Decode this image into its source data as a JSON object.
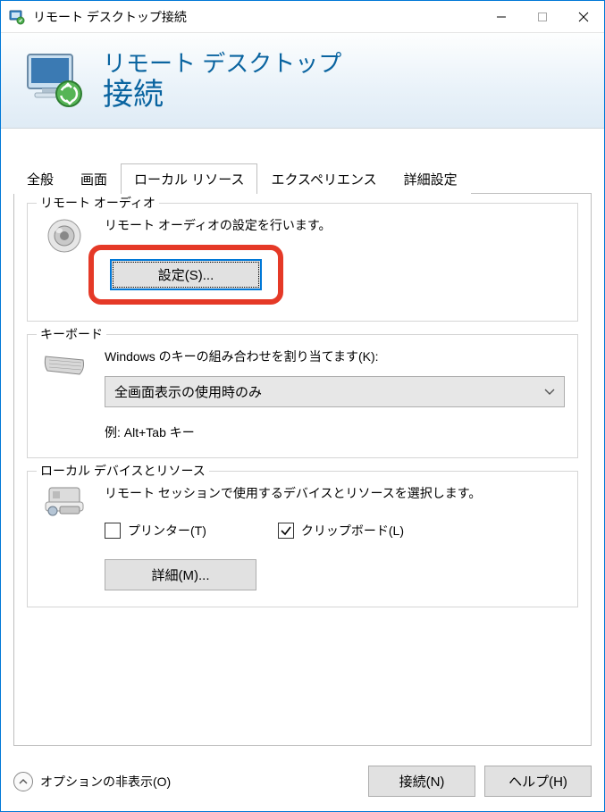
{
  "titlebar": {
    "title": "リモート デスクトップ接続"
  },
  "header": {
    "line1": "リモート デスクトップ",
    "line2": "接続"
  },
  "tabs": {
    "general": "全般",
    "display": "画面",
    "local_resources": "ローカル リソース",
    "experience": "エクスペリエンス",
    "advanced": "詳細設定"
  },
  "audio": {
    "legend": "リモート オーディオ",
    "desc": "リモート オーディオの設定を行います。",
    "settings_btn": "設定(S)..."
  },
  "keyboard": {
    "legend": "キーボード",
    "desc": "Windows のキーの組み合わせを割り当てます(K):",
    "selected": "全画面表示の使用時のみ",
    "example": "例: Alt+Tab キー"
  },
  "devices": {
    "legend": "ローカル デバイスとリソース",
    "desc": "リモート セッションで使用するデバイスとリソースを選択します。",
    "printer": "プリンター(T)",
    "clipboard": "クリップボード(L)",
    "more_btn": "詳細(M)..."
  },
  "footer": {
    "hide_options": "オプションの非表示(O)",
    "connect": "接続(N)",
    "help": "ヘルプ(H)"
  }
}
